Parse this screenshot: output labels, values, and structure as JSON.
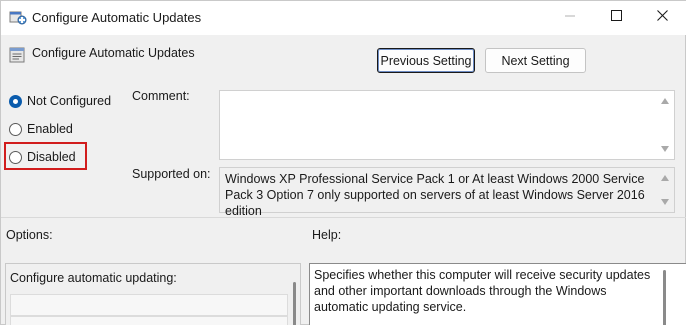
{
  "window": {
    "title": "Configure Automatic Updates",
    "icon": "policy-settings-icon",
    "controls": {
      "minimize": "minimize-icon",
      "maximize": "maximize-icon",
      "close": "close-icon"
    }
  },
  "header": {
    "title": "Configure Automatic Updates",
    "icon": "policy-setting-icon",
    "prev_button": "Previous Setting",
    "next_button": "Next Setting"
  },
  "state": {
    "options": [
      {
        "label": "Not Configured",
        "checked": true
      },
      {
        "label": "Enabled",
        "checked": false
      },
      {
        "label": "Disabled",
        "checked": false
      }
    ],
    "highlighted": "Disabled"
  },
  "comment": {
    "label": "Comment:",
    "value": ""
  },
  "supported": {
    "label": "Supported on:",
    "value": "Windows XP Professional Service Pack 1 or At least Windows 2000 Service Pack 3 Option 7 only supported on servers of at least Windows Server 2016 edition"
  },
  "options_section": {
    "label": "Options:",
    "field_label": "Configure automatic updating:"
  },
  "help_section": {
    "label": "Help:",
    "text": "Specifies whether this computer will receive security updates and other important downloads through the Windows automatic updating service."
  },
  "colors": {
    "accent": "#0b5cad",
    "highlight_border": "#d11c1c",
    "window_bg": "#f0f0f0"
  }
}
